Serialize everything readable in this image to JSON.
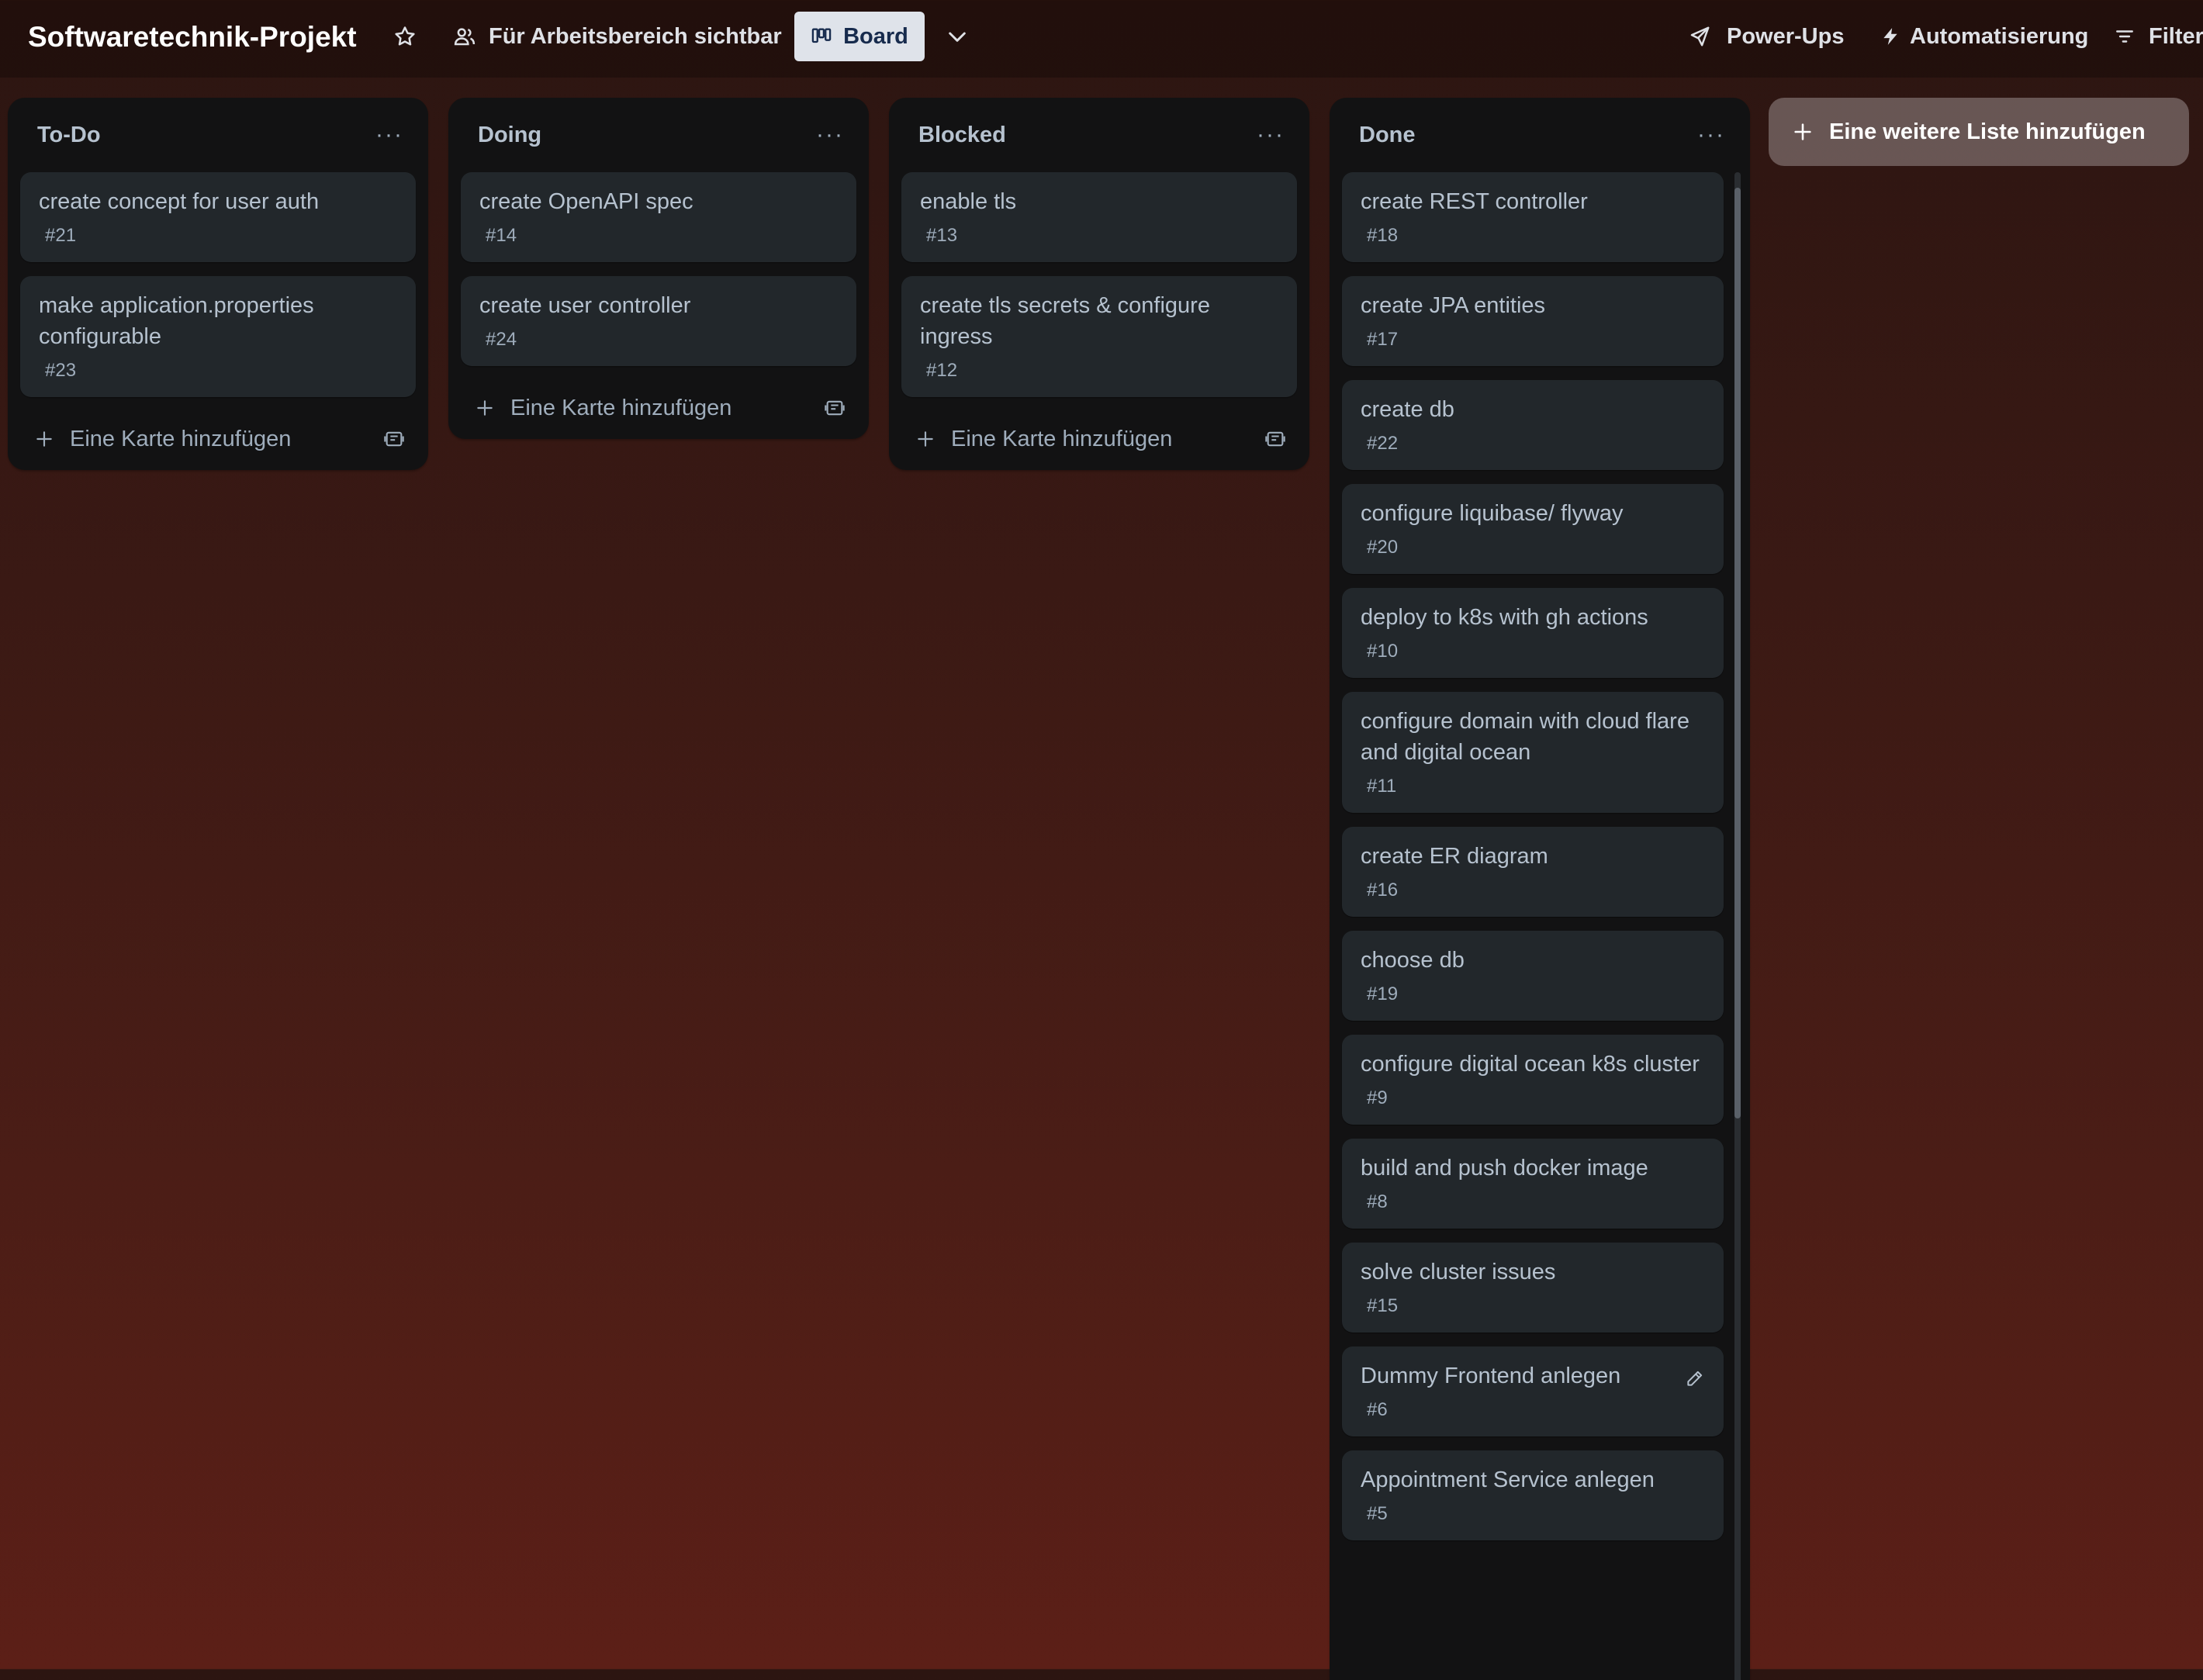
{
  "board": {
    "title": "Softwaretechnik-Projekt",
    "visibility_label": "Für Arbeitsbereich sichtbar",
    "view_label": "Board",
    "powerups_label": "Power-Ups",
    "automation_label": "Automatisierung",
    "filter_label": "Filter"
  },
  "lists": [
    {
      "title": "To-Do",
      "menu": "···",
      "add_card_label": "Eine Karte hinzufügen",
      "cards": [
        {
          "title": "create concept for user auth",
          "number": "#21"
        },
        {
          "title": "make application.properties configurable",
          "number": "#23"
        }
      ]
    },
    {
      "title": "Doing",
      "menu": "···",
      "add_card_label": "Eine Karte hinzufügen",
      "cards": [
        {
          "title": "create OpenAPI spec",
          "number": "#14"
        },
        {
          "title": "create user controller",
          "number": "#24"
        }
      ]
    },
    {
      "title": "Blocked",
      "menu": "···",
      "add_card_label": "Eine Karte hinzufügen",
      "cards": [
        {
          "title": "enable tls",
          "number": "#13"
        },
        {
          "title": "create tls secrets & configure ingress",
          "number": "#12"
        }
      ]
    },
    {
      "title": "Done",
      "menu": "···",
      "cards": [
        {
          "title": "create REST controller",
          "number": "#18"
        },
        {
          "title": "create JPA entities",
          "number": "#17"
        },
        {
          "title": "create db",
          "number": "#22"
        },
        {
          "title": "configure liquibase/ flyway",
          "number": "#20"
        },
        {
          "title": "deploy to k8s with gh actions",
          "number": "#10"
        },
        {
          "title": "configure domain with cloud flare and digital ocean",
          "number": "#11"
        },
        {
          "title": "create ER diagram",
          "number": "#16"
        },
        {
          "title": "choose db",
          "number": "#19"
        },
        {
          "title": "configure digital ocean k8s cluster",
          "number": "#9"
        },
        {
          "title": "build and push docker image",
          "number": "#8"
        },
        {
          "title": "solve cluster issues",
          "number": "#15"
        },
        {
          "title": "Dummy Frontend anlegen",
          "number": "#6"
        },
        {
          "title": "Appointment Service anlegen",
          "number": "#5"
        }
      ]
    }
  ],
  "add_list_label": "Eine weitere Liste hinzufügen",
  "icons": {
    "star": "star-icon",
    "visibility": "workspace-people-icon",
    "board_view": "board-columns-icon",
    "chevron": "chevron-down-icon",
    "powerups": "rocket-icon",
    "automation": "lightning-icon",
    "filter": "filter-icon",
    "plus": "plus-icon",
    "template": "card-template-icon",
    "edit": "pencil-icon"
  }
}
